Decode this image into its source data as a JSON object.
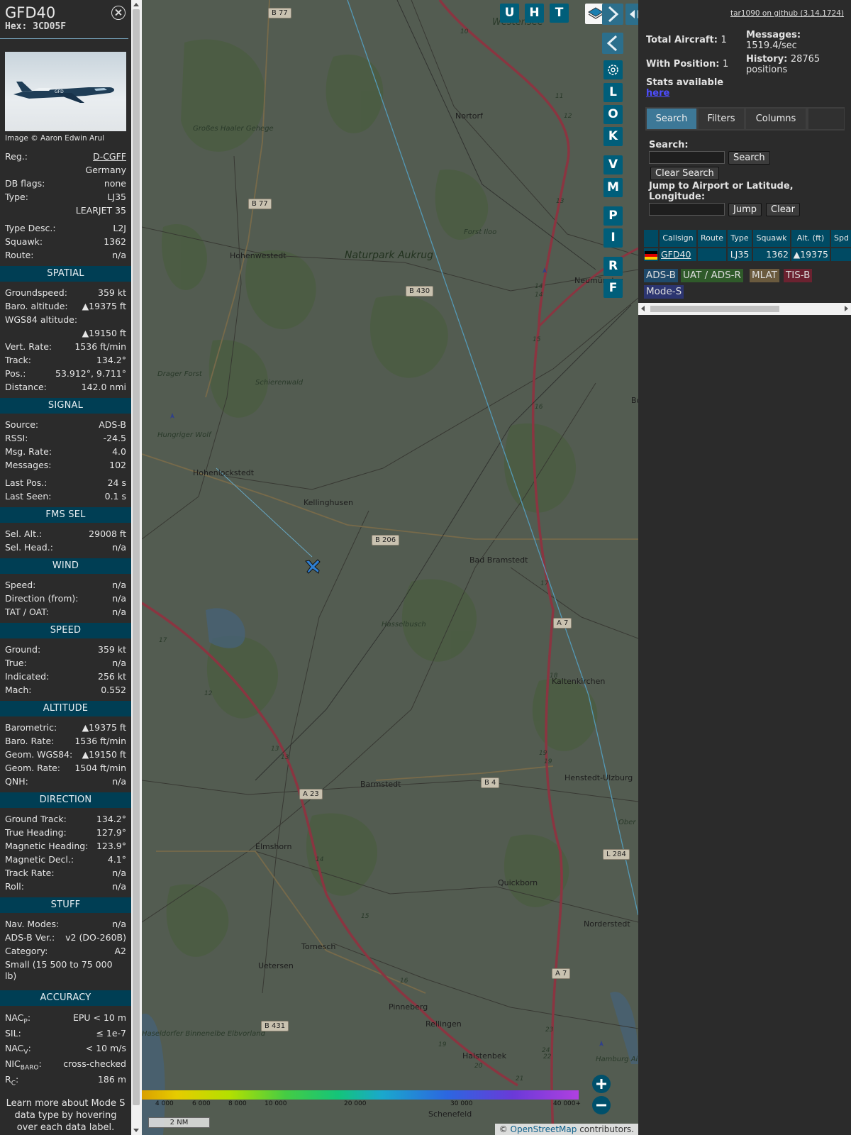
{
  "sidebar": {
    "callsign": "GFD40",
    "hex_label": "Hex:",
    "hex": "3CD05F",
    "photo_credit": "Image © Aaron Edwin Arul",
    "photo_livery": "GFD",
    "reg_label": "Reg.:",
    "reg": "D-CGFF",
    "country": "Germany",
    "dbflags_label": "DB flags:",
    "dbflags": "none",
    "type_label": "Type:",
    "type_code": "LJ35",
    "type_name": "LEARJET 35",
    "typedesc_label": "Type Desc.:",
    "typedesc": "L2J",
    "squawk_label": "Squawk:",
    "squawk": "1362",
    "route_label": "Route:",
    "route": "n/a",
    "spatial": {
      "title": "SPATIAL",
      "gs_label": "Groundspeed:",
      "gs": "359 kt",
      "baro_label": "Baro. altitude:",
      "baro": "▲19375 ft",
      "wgs_label": "WGS84 altitude:",
      "wgs": "▲19150 ft",
      "vr_label": "Vert. Rate:",
      "vr": "1536 ft/min",
      "track_label": "Track:",
      "track": "134.2°",
      "pos_label": "Pos.:",
      "pos": "53.912°, 9.711°",
      "dist_label": "Distance:",
      "dist": "142.0 nmi"
    },
    "signal": {
      "title": "SIGNAL",
      "src_label": "Source:",
      "src": "ADS-B",
      "rssi_label": "RSSI:",
      "rssi": "-24.5",
      "rate_label": "Msg. Rate:",
      "rate": "4.0",
      "msgs_label": "Messages:",
      "msgs": "102",
      "lastpos_label": "Last Pos.:",
      "lastpos": "24 s",
      "lastseen_label": "Last Seen:",
      "lastseen": "0.1 s"
    },
    "fms": {
      "title": "FMS SEL",
      "alt_label": "Sel. Alt.:",
      "alt": "29008 ft",
      "head_label": "Sel. Head.:",
      "head": "n/a"
    },
    "wind": {
      "title": "WIND",
      "speed_label": "Speed:",
      "speed": "n/a",
      "dir_label": "Direction (from):",
      "dir": "n/a",
      "tat_label": "TAT / OAT:",
      "tat": "n/a"
    },
    "speed": {
      "title": "SPEED",
      "ground_label": "Ground:",
      "ground": "359 kt",
      "true_label": "True:",
      "true": "n/a",
      "ind_label": "Indicated:",
      "ind": "256 kt",
      "mach_label": "Mach:",
      "mach": "0.552"
    },
    "altitude": {
      "title": "ALTITUDE",
      "baro_label": "Barometric:",
      "baro": "▲19375 ft",
      "brate_label": "Baro. Rate:",
      "brate": "1536 ft/min",
      "geom_label": "Geom. WGS84:",
      "geom": "▲19150 ft",
      "grate_label": "Geom. Rate:",
      "grate": "1504 ft/min",
      "qnh_label": "QNH:",
      "qnh": "n/a"
    },
    "direction": {
      "title": "DIRECTION",
      "gt_label": "Ground Track:",
      "gt": "134.2°",
      "th_label": "True Heading:",
      "th": "127.9°",
      "mh_label": "Magnetic Heading:",
      "mh": "123.9°",
      "md_label": "Magnetic Decl.:",
      "md": "4.1°",
      "tr_label": "Track Rate:",
      "tr": "n/a",
      "roll_label": "Roll:",
      "roll": "n/a"
    },
    "stuff": {
      "title": "STUFF",
      "nav_label": "Nav. Modes:",
      "nav": "n/a",
      "adsb_label": "ADS-B Ver.:",
      "adsb": "v2 (DO-260B)",
      "cat_label": "Category:",
      "cat": "A2",
      "cat_desc": "Small (15 500 to 75 000 lb)"
    },
    "accuracy": {
      "title": "ACCURACY",
      "nacp_label": "NAC",
      "nacp_sub": "P",
      "nacp": "EPU < 10 m",
      "sil_label": "SIL:",
      "sil": "≤ 1e-7",
      "nacv_label": "NAC",
      "nacv_sub": "V",
      "nacv": "< 10 m/s",
      "nic_label": "NIC",
      "nic_sub": "BARO",
      "nic": "cross-checked",
      "rc_label": "R",
      "rc_sub": "C",
      "rc": "186 m"
    },
    "footer": "Learn more about Mode S data type by hovering over each data label."
  },
  "map": {
    "buttons_top": [
      "U",
      "H",
      "T"
    ],
    "buttons_side": [
      "L",
      "O",
      "K",
      "V",
      "M",
      "P",
      "I",
      "R",
      "F"
    ],
    "places": [
      "Westensee",
      "Nortorf",
      "Großes Haaler Gehege",
      "Hohenwestedt",
      "Naturpark Aukrug",
      "Forst Iloo",
      "Neumünster",
      "Drager Forst",
      "Schierenwald",
      "Hungriger Wolf",
      "Hohenlockstedt",
      "Kellinghusen",
      "Bad Bramstedt",
      "Hasselbusch",
      "Kaltenkirchen",
      "Barmstedt",
      "Henstedt-Ulzburg",
      "Elmshorn",
      "Quickborn",
      "Norderstedt",
      "Tornesch",
      "Uetersen",
      "Pinneberg",
      "Rellingen",
      "Halstenbek",
      "Schenefeld",
      "Haseldorfer Binnenelbe Elbvorland",
      "Hamburg Airport Helmut",
      "Bo",
      "Ober"
    ],
    "roads": [
      "B 77",
      "B 77",
      "B 430",
      "B 206",
      "A 7",
      "B 4",
      "A 23",
      "L 284",
      "A 7",
      "B 431"
    ],
    "km": [
      "10",
      "11",
      "12",
      "13",
      "14",
      "14",
      "15",
      "16",
      "17",
      "18",
      "19",
      "19",
      "17",
      "12",
      "13",
      "13",
      "14",
      "15",
      "16",
      "19",
      "20",
      "21",
      "22",
      "23",
      "24"
    ],
    "legend_ticks": [
      "4 000",
      "6 000",
      "8 000",
      "10 000",
      "20 000",
      "30 000",
      "40 000+"
    ],
    "scale": "2 NM",
    "attribution_prefix": "© ",
    "attribution_link": "OpenStreetMap",
    "attribution_suffix": " contributors."
  },
  "panel": {
    "github": "tar1090 on github (3.14.1724)",
    "total_label": "Total Aircraft:",
    "total": "1",
    "withpos_label": "With Position:",
    "withpos": "1",
    "stats_label": "Stats available",
    "stats_link": "here",
    "messages_label": "Messages:",
    "messages": "1519.4/sec",
    "history_label": "History:",
    "history": "28765 positions",
    "tabs": [
      "Search",
      "Filters",
      "Columns"
    ],
    "search_label": "Search:",
    "search_button": "Search",
    "clear_search": "Clear Search",
    "jump_label": "Jump to Airport or Latitude, Longitude:",
    "jump_button": "Jump",
    "clear_button": "Clear",
    "columns": [
      "Callsign",
      "Route",
      "Type",
      "Squawk",
      "Alt. (ft)",
      "Spd"
    ],
    "row": {
      "callsign": "GFD40",
      "route": "",
      "type": "LJ35",
      "squawk": "1362",
      "alt": "▲19375"
    },
    "chips": [
      {
        "label": "ADS-B",
        "bg": "#1f4a6b"
      },
      {
        "label": "UAT / ADS-R",
        "bg": "#2f5a2a"
      },
      {
        "label": "MLAT",
        "bg": "#6a5a3e"
      },
      {
        "label": "TIS-B",
        "bg": "#6b2230"
      },
      {
        "label": "Mode-S",
        "bg": "#2c3570"
      }
    ]
  }
}
